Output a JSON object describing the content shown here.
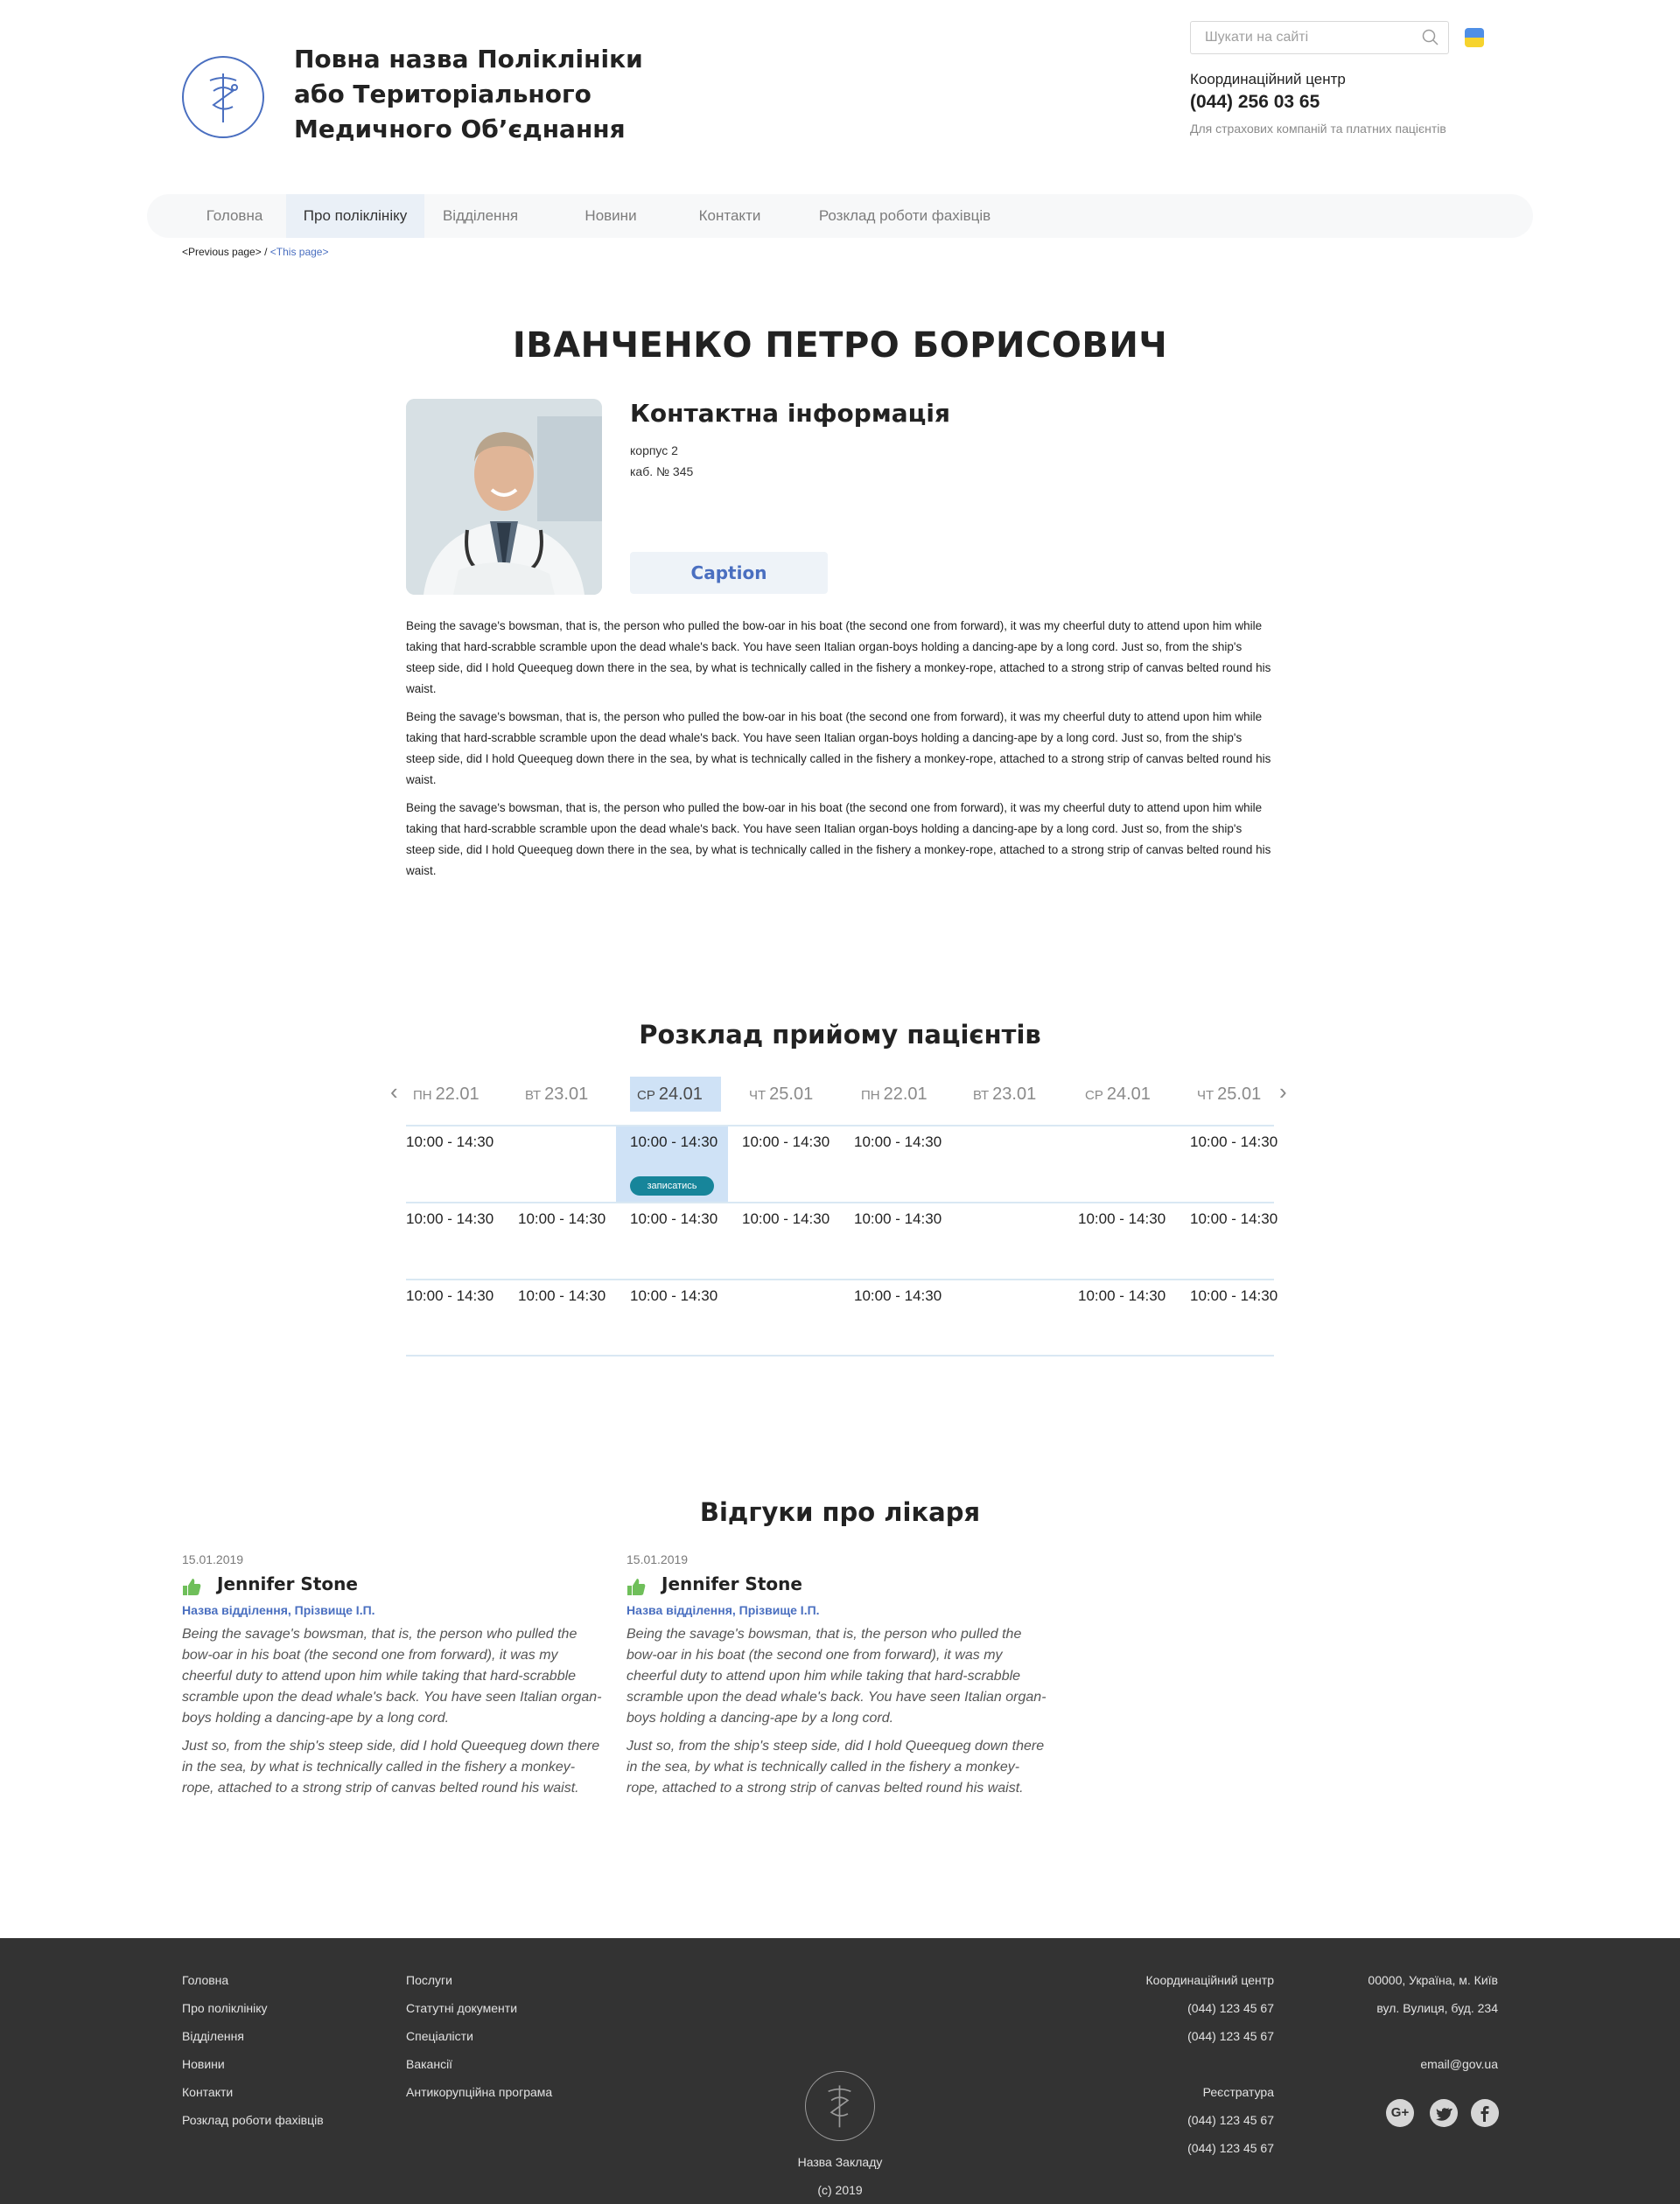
{
  "header": {
    "site_title": "Повна назва Поліклініки або Територіального Медичного Об’єднання",
    "search_placeholder": "Шукати на сайті",
    "coordination_title": "Координаційний центр",
    "coordination_phone": "(044) 256 03 65",
    "coordination_note": "Для страхових компаній та платних пацієнтів"
  },
  "nav": {
    "items": [
      "Головна",
      "Про поліклініку",
      "Відділення",
      "Новини",
      "Контакти",
      "Розклад роботи фахівців"
    ],
    "active_index": 1
  },
  "breadcrumb": {
    "previous": "<Previous page>",
    "separator": "/",
    "current": "<This page>"
  },
  "doctor": {
    "name": "ІВАНЧЕНКО ПЕТРО БОРИСОВИЧ",
    "contact_heading": "Контактна інформація",
    "building": "корпус 2",
    "office": "каб. № 345",
    "caption_button": "Caption",
    "bio": [
      "Being the savage's bowsman, that is, the person who pulled the bow-oar in his boat (the second one from forward), it was my cheerful duty to attend upon him while taking that hard-scrabble scramble upon the dead whale's back. You have seen Italian organ-boys holding a dancing-ape by a long cord. Just so, from the ship's steep side, did I hold Queequeg down there in the sea, by what is technically called in the fishery a monkey-rope, attached to a strong strip of canvas belted round his waist.",
      "Being the savage's bowsman, that is, the person who pulled the bow-oar in his boat (the second one from forward), it was my cheerful duty to attend upon him while taking that hard-scrabble scramble upon the dead whale's back. You have seen Italian organ-boys holding a dancing-ape by a long cord. Just so, from the ship's steep side, did I hold Queequeg down there in the sea, by what is technically called in the fishery a monkey-rope, attached to a strong strip of canvas belted round his waist.",
      "Being the savage's bowsman, that is, the person who pulled the bow-oar in his boat (the second one from forward), it was my cheerful duty to attend upon him while taking that hard-scrabble scramble upon the dead whale's back. You have seen Italian organ-boys holding a dancing-ape by a long cord. Just so, from the ship's steep side, did I hold Queequeg down there in the sea, by what is technically called in the fishery a monkey-rope, attached to a strong strip of canvas belted round his waist."
    ]
  },
  "schedule": {
    "title": "Розклад прийому пацієнтів",
    "days": [
      {
        "dow": "ПН",
        "date": "22.01"
      },
      {
        "dow": "ВТ",
        "date": "23.01"
      },
      {
        "dow": "СР",
        "date": "24.01"
      },
      {
        "dow": "ЧТ",
        "date": "25.01"
      },
      {
        "dow": "ПН",
        "date": "22.01"
      },
      {
        "dow": "ВТ",
        "date": "23.01"
      },
      {
        "dow": "СР",
        "date": "24.01"
      },
      {
        "dow": "ЧТ",
        "date": "25.01"
      }
    ],
    "selected_day_index": 2,
    "rows": [
      [
        "10:00 - 14:30",
        "",
        "10:00 - 14:30",
        "10:00 - 14:30",
        "10:00 - 14:30",
        "",
        "",
        "10:00 - 14:30"
      ],
      [
        "10:00 - 14:30",
        "10:00 - 14:30",
        "10:00 - 14:30",
        "10:00 - 14:30",
        "10:00 - 14:30",
        "",
        "10:00 - 14:30",
        "10:00 - 14:30"
      ],
      [
        "10:00 - 14:30",
        "10:00 - 14:30",
        "10:00 - 14:30",
        "",
        "10:00 - 14:30",
        "",
        "10:00 - 14:30",
        "10:00 - 14:30"
      ]
    ],
    "book_button": "записатись"
  },
  "reviews": {
    "title": "Відгуки про лікаря",
    "items": [
      {
        "date": "15.01.2019",
        "name": "Jennifer Stone",
        "dept": "Назва відділення, Прізвище І.П.",
        "text1": "Being the savage's bowsman, that is, the person who pulled the bow-oar in his boat (the second one from forward), it was my cheerful duty to attend upon him while taking that hard-scrabble scramble upon the dead whale's back. You have seen Italian organ-boys holding a dancing-ape by a long cord.",
        "text2": "Just so, from the ship's steep side, did I hold Queequeg down there in the sea, by what is technically called in the fishery a monkey-rope, attached to a strong strip of canvas belted round his waist."
      },
      {
        "date": "15.01.2019",
        "name": "Jennifer Stone",
        "dept": "Назва відділення, Прізвище І.П.",
        "text1": "Being the savage's bowsman, that is, the person who pulled the bow-oar in his boat (the second one from forward), it was my cheerful duty to attend upon him while taking that hard-scrabble scramble upon the dead whale's back. You have seen Italian organ-boys holding a dancing-ape by a long cord.",
        "text2": "Just so, from the ship's steep side, did I hold Queequeg down there in the sea, by what is technically called in the fishery a monkey-rope, attached to a strong strip of canvas belted round his waist."
      }
    ]
  },
  "footer": {
    "col1": [
      "Головна",
      "Про поліклініку",
      "Відділення",
      "Новини",
      "Контакти",
      "Розклад роботи фахівців"
    ],
    "col2": [
      "Послуги",
      "Статутні документи",
      "Спеціалісти",
      "Вакансії",
      "Антикорупційна програма"
    ],
    "center_name": "Назва Закладу",
    "copyright": "(c) 2019",
    "coord_title": "Координаційний центр",
    "coord_phone1": "(044) 123 45 67",
    "coord_phone2": "(044) 123 45 67",
    "reg_title": "Реєстратура",
    "reg_phone1": "(044) 123 45 67",
    "reg_phone2": "(044) 123 45 67",
    "address1": "00000, Україна, м. Київ",
    "address2": "вул. Вулиця, буд. 234",
    "email": "email@gov.ua",
    "social": [
      "G+",
      "twitter",
      "facebook"
    ]
  },
  "colors": {
    "accent": "#4a6fc0",
    "teal": "#17859a",
    "selected": "#cfe2f6",
    "footer_bg": "#333333"
  }
}
